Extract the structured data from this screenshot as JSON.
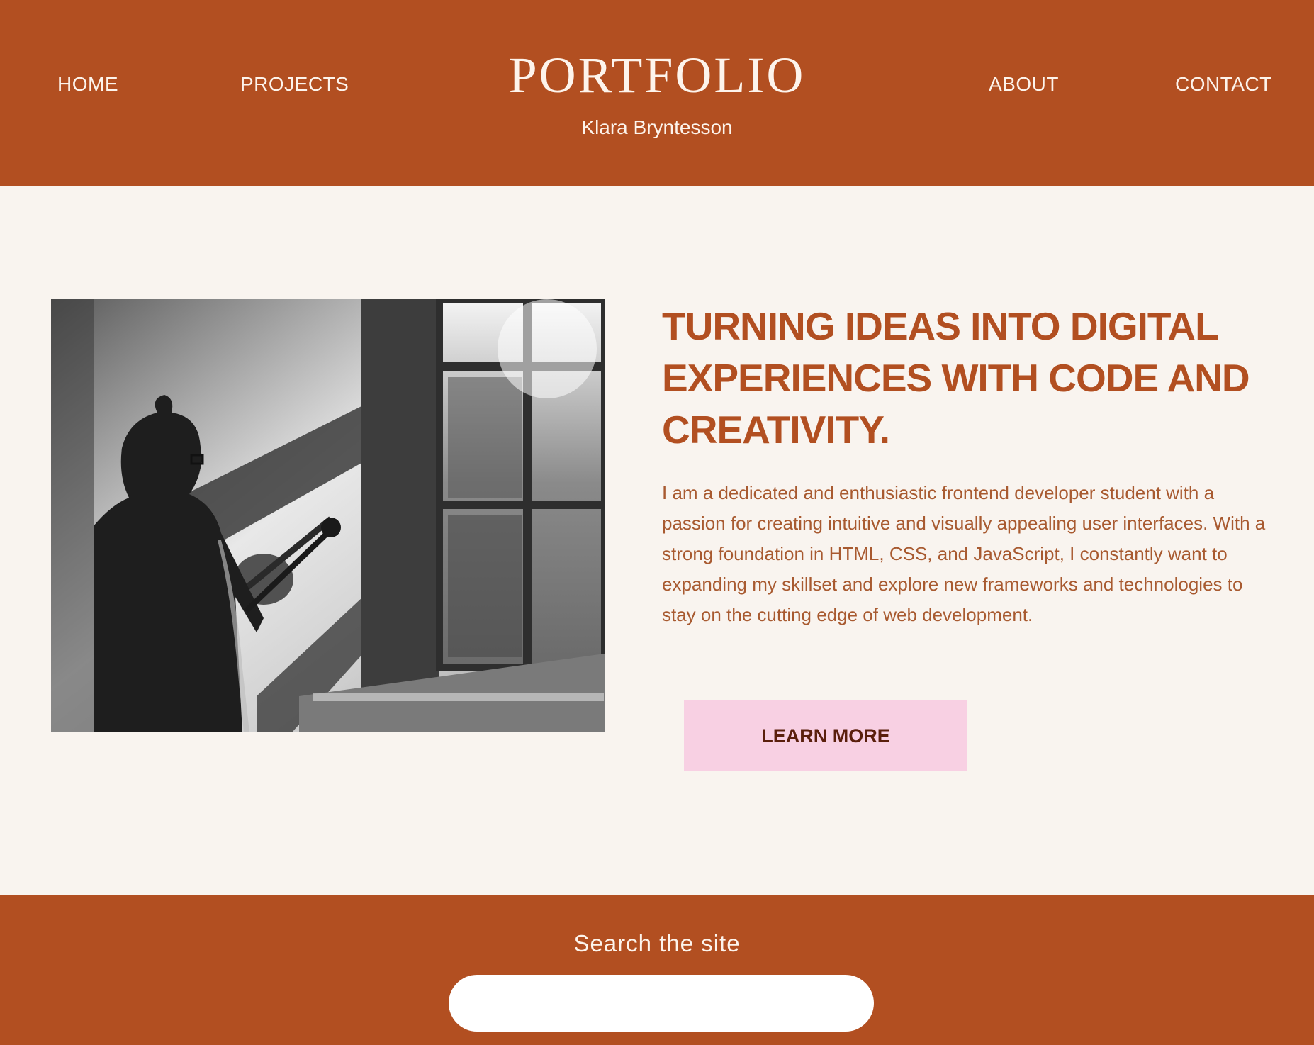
{
  "header": {
    "nav": {
      "home": "HOME",
      "projects": "PROJECTS",
      "about": "ABOUT",
      "contact": "CONTACT"
    },
    "brand_title": "PORTFOLIO",
    "brand_subtitle": "Klara Bryntesson"
  },
  "hero": {
    "photo_icon": "portrait-photo",
    "heading": "TURNING IDEAS INTO DIGITAL EXPERIENCES WITH CODE AND CREATIVITY.",
    "body": "I am a dedicated and enthusiastic frontend developer student with a passion for creating intuitive and visually appealing user interfaces. With a strong foundation in HTML, CSS, and JavaScript, I constantly want to expanding my skillset and explore new frameworks and technologies to stay on the cutting edge of web development.",
    "cta_label": "LEARN MORE"
  },
  "footer": {
    "search_label": "Search the site",
    "search_value": "",
    "search_placeholder": ""
  },
  "colors": {
    "brand": "#b24f21",
    "background": "#f9f4ef",
    "cta": "#f8d0e3",
    "cta_text": "#5a1f0c"
  }
}
